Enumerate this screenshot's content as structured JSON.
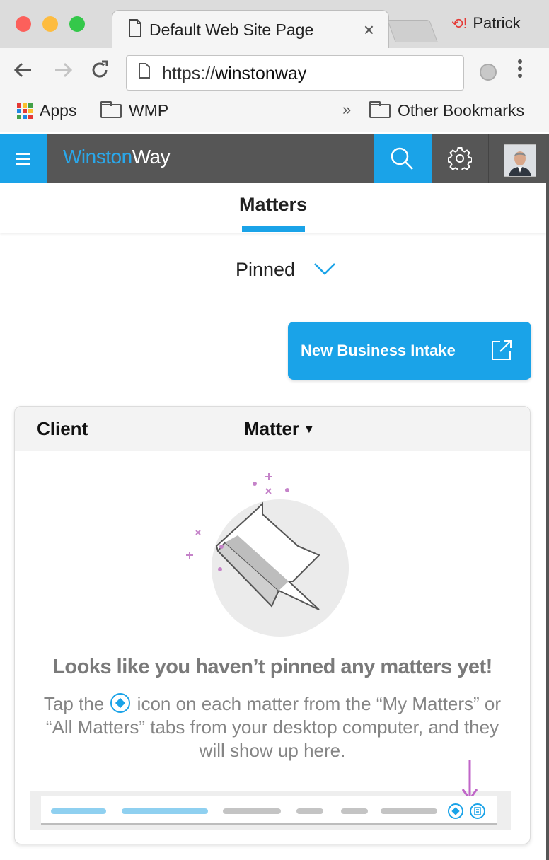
{
  "browser": {
    "tab_title": "Default Web Site Page",
    "tab_close": "×",
    "profile_name": "Patrick",
    "url_prefix": "https://",
    "url_host": "winstonway",
    "bookmarks": {
      "apps": "Apps",
      "wmp": "WMP",
      "overflow": "»",
      "other": "Other Bookmarks"
    }
  },
  "app": {
    "brand_part1": "Winston",
    "brand_part2": "Way",
    "active_tab": "Matters",
    "filter_label": "Pinned",
    "new_business_intake": "New Business Intake",
    "accent_color": "#1aa3e8"
  },
  "table": {
    "columns": [
      "Client",
      "Matter"
    ]
  },
  "empty_state": {
    "title": "Looks like you haven’t pinned any matters yet!",
    "text_before_icon": "Tap the ",
    "text_after_icon": " icon on each matter from the “My Matters” or “All Matters” tabs from your desktop computer, and they will show up here."
  }
}
